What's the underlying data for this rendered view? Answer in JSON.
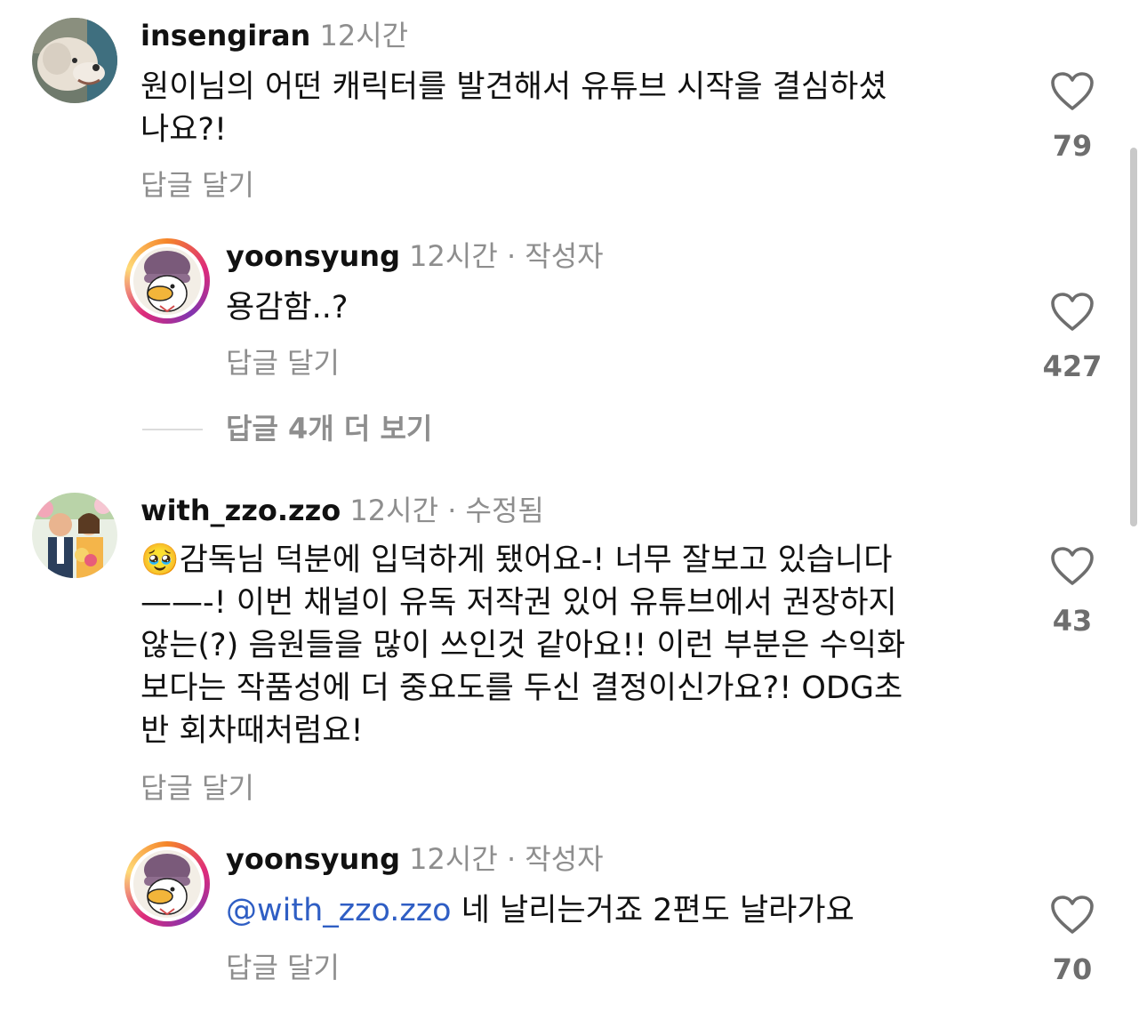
{
  "comments": [
    {
      "username": "insengiran",
      "time": "12시간",
      "text": "원이님의 어떤 캐릭터를 발견해서 유튜브 시작을 결심하셨\n나요?!",
      "reply_label": "답글 달기",
      "likes": "79"
    },
    {
      "username": "yoonsyung",
      "time": "12시간",
      "separator": "·",
      "badge": "작성자",
      "text": "용감함..?",
      "reply_label": "답글 달기",
      "likes": "427"
    },
    {
      "username": "with_zzo.zzo",
      "time": "12시간",
      "separator": "·",
      "badge": "수정됨",
      "emoji": "🥹",
      "text": "감독님 덕분에 입덕하게 됐어요-! 너무 잘보고 있습니다\n——-! 이번 채널이 유독 저작권 있어 유튜브에서 권장하지\n않는(?) 음원들을 많이 쓰인것 같아요!! 이런 부분은 수익화\n보다는 작품성에 더 중요도를 두신 결정이신가요?! ODG초\n반 회차때처럼요!",
      "reply_label": "답글 달기",
      "likes": "43"
    },
    {
      "username": "yoonsyung",
      "time": "12시간",
      "separator": "·",
      "badge": "작성자",
      "mention": "@with_zzo.zzo",
      "text": " 네 날리는거죠 2편도 날라가요",
      "reply_label": "답글 달기",
      "likes": "70"
    }
  ],
  "more_replies": "답글 4개 더 보기",
  "icons": {
    "like": "heart-outline-icon"
  },
  "colors": {
    "mention": "#2f5ec4",
    "secondary_text": "#8e8e8e",
    "ring_gradient": [
      "#f58529",
      "#dd2a7b",
      "#8134af",
      "#feda77"
    ]
  }
}
